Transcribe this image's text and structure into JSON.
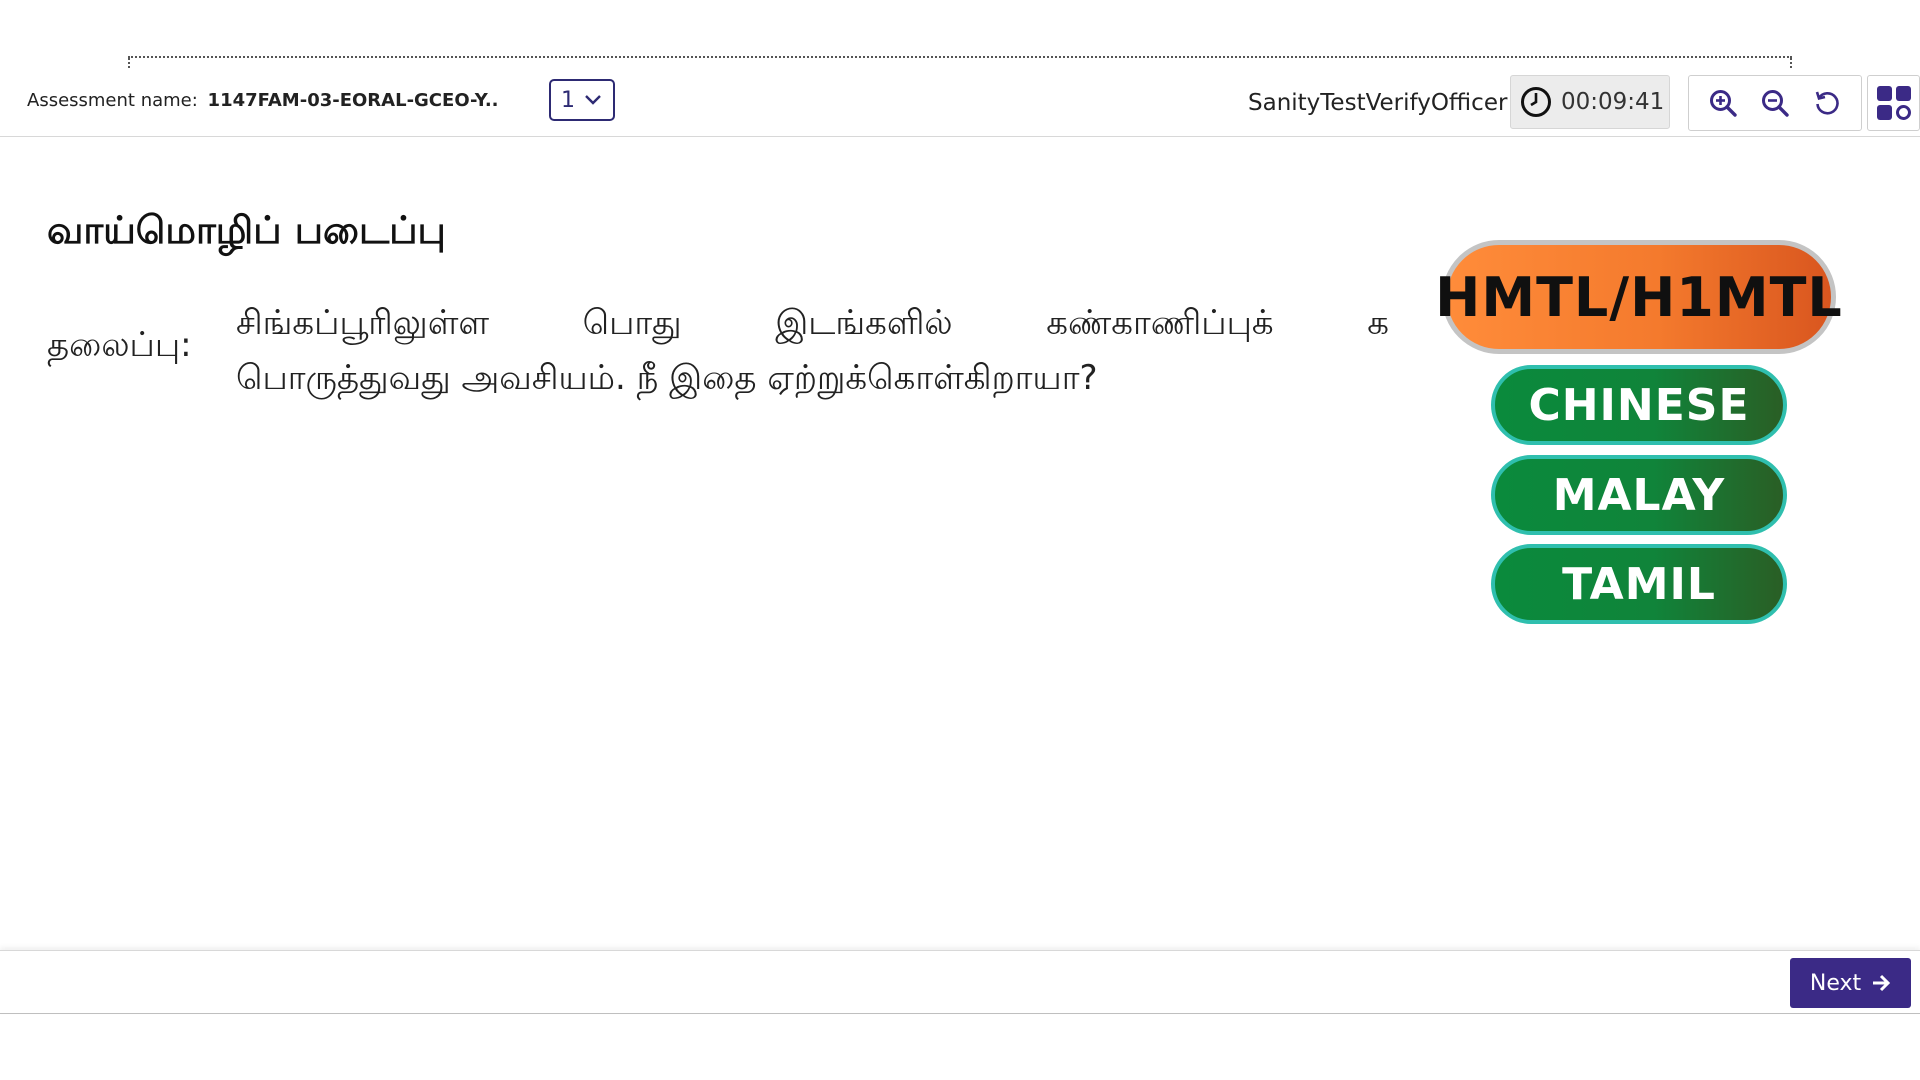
{
  "header": {
    "assessment_label": "Assessment name:",
    "assessment_name": "1147FAM-03-EORAL-GCEO-Y..",
    "page_select_value": "1",
    "user_name": "SanityTestVerifyOfficer",
    "timer": "00:09:41",
    "icons": [
      "clock-icon",
      "zoom-in-icon",
      "zoom-out-icon",
      "reset-icon",
      "grid-menu-icon"
    ]
  },
  "content": {
    "title": "வாய்மொழிப் படைப்பு",
    "topic_label": "தலைப்பு:",
    "topic_words_line1": [
      "சிங்கப்பூரிலுள்ள",
      "பொது",
      "இடங்களில்",
      "கண்காணிப்புக்",
      "க"
    ],
    "topic_line2": "பொருத்துவது அவசியம். நீ இதை ஏற்றுக்கொள்கிறாயா?"
  },
  "languages": {
    "selected": "HMTL/H1MTL",
    "options": [
      "CHINESE",
      "MALAY",
      "TAMIL"
    ]
  },
  "footer": {
    "next_label": "Next"
  },
  "colors": {
    "brand_purple": "#3b2a86",
    "selected_lang": "#f47a2d",
    "lang_button": "#0a8a3c"
  }
}
